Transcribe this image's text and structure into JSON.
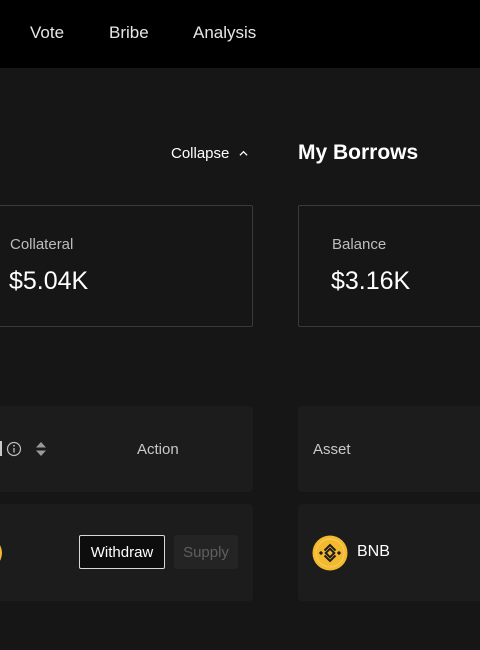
{
  "nav": {
    "items": [
      {
        "label": "Vote"
      },
      {
        "label": "Bribe"
      },
      {
        "label": "Analysis"
      }
    ]
  },
  "supply_section": {
    "collapse_label": "Collapse",
    "collateral_label": "Collateral",
    "collateral_value": "$5.04K",
    "table": {
      "action_header": "Action",
      "row": {
        "withdraw_label": "Withdraw",
        "supply_label": "Supply"
      }
    }
  },
  "borrow_section": {
    "title": "My Borrows",
    "balance_label": "Balance",
    "balance_value": "$3.16K",
    "table": {
      "asset_header": "Asset",
      "row": {
        "asset_name": "BNB"
      }
    }
  },
  "colors": {
    "background": "#161616",
    "topbar": "#000000",
    "panel": "#1c1c1c",
    "card_border": "#3a3a3a",
    "bnb_yellow": "#F3BA2F"
  },
  "icons": [
    "info-icon",
    "sort-icon",
    "chevron-up-icon",
    "bnb-token-icon"
  ]
}
